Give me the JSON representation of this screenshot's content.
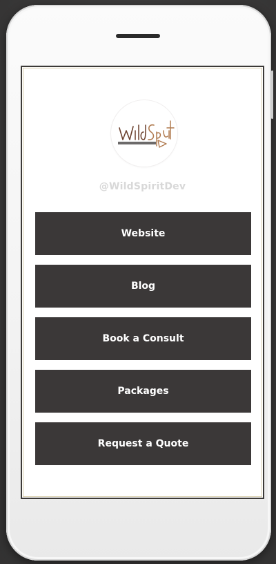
{
  "profile": {
    "logo_alt": "Wild Spirit Development",
    "handle": "@WildSpiritDev"
  },
  "links": [
    {
      "label": "Website"
    },
    {
      "label": "Blog"
    },
    {
      "label": "Book a Consult"
    },
    {
      "label": "Packages"
    },
    {
      "label": "Request a Quote"
    }
  ],
  "colors": {
    "background": "#3d3c3c",
    "phone_body": "#f6f6f6",
    "button_fill": "#3b3838",
    "button_text": "#ffffff",
    "handle_text": "#d8d8d8",
    "logo_accent": "#b07a4f"
  }
}
